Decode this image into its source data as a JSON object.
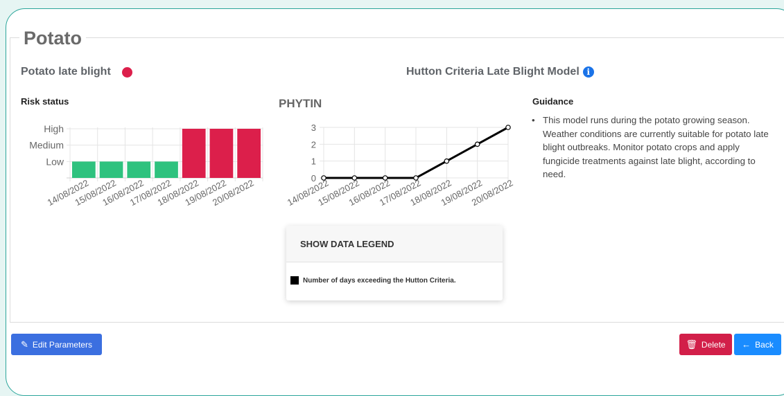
{
  "section": {
    "title": "Potato"
  },
  "disease": {
    "name": "Potato late blight",
    "status_color": "#dc1f4b"
  },
  "model": {
    "title": "Hutton Criteria Late Blight Model",
    "info_icon": "info-circle-icon"
  },
  "risk_chart": {
    "label": "Risk status",
    "chart_data": {
      "type": "bar",
      "categories": [
        "14/08/2022",
        "15/08/2022",
        "16/08/2022",
        "17/08/2022",
        "18/08/2022",
        "19/08/2022",
        "20/08/2022"
      ],
      "values": [
        1,
        1,
        1,
        1,
        3,
        3,
        3
      ],
      "y_tick_labels": [
        "Low",
        "Medium",
        "High"
      ],
      "ylim": [
        0,
        3
      ],
      "colors": [
        "#2ec27e",
        "#2ec27e",
        "#2ec27e",
        "#2ec27e",
        "#dc1f4b",
        "#dc1f4b",
        "#dc1f4b"
      ],
      "grid": true
    }
  },
  "phytin_chart": {
    "label": "PHYTIN",
    "chart_data": {
      "type": "line",
      "categories": [
        "14/08/2022",
        "15/08/2022",
        "16/08/2022",
        "17/08/2022",
        "18/08/2022",
        "19/08/2022",
        "20/08/2022"
      ],
      "values": [
        0,
        0,
        0,
        0,
        1,
        2,
        3
      ],
      "y_ticks": [
        0,
        1,
        2,
        3
      ],
      "ylim": [
        0,
        3
      ],
      "line_color": "#000000",
      "grid": true
    }
  },
  "guidance": {
    "label": "Guidance",
    "text": "This model runs during the potato growing season. Weather conditions are currently suitable for potato late blight outbreaks. Monitor potato crops and apply fungicide treatments against late blight, according to need."
  },
  "legend": {
    "toggle_label": "SHOW DATA LEGEND",
    "items": [
      {
        "label": "Number of days exceeding the Hutton Criteria.",
        "color": "#000000"
      }
    ]
  },
  "buttons": {
    "edit": {
      "label": "Edit Parameters",
      "icon": "edit-icon"
    },
    "delete": {
      "label": "Delete",
      "icon": "trash-icon"
    },
    "back": {
      "label": "Back",
      "icon": "arrow-left-icon"
    }
  }
}
